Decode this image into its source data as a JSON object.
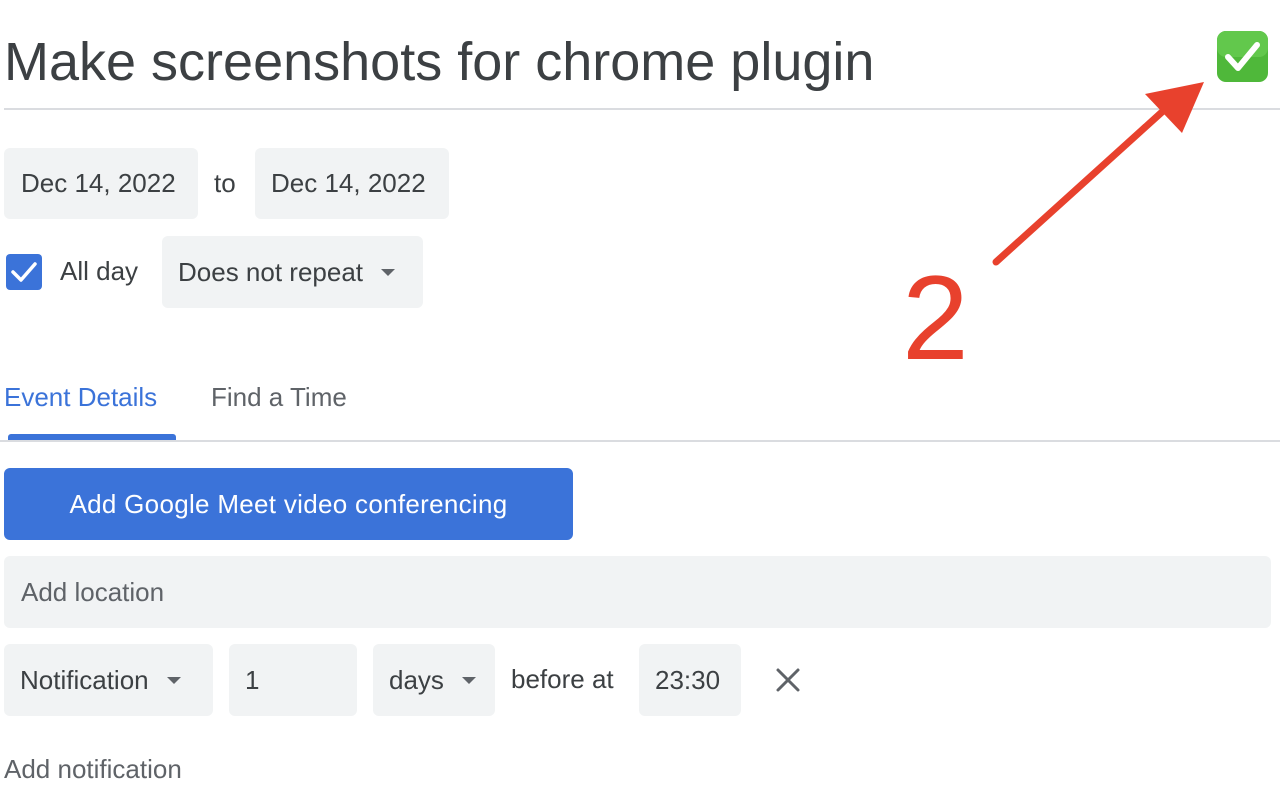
{
  "event": {
    "title": "Make screenshots for chrome plugin",
    "start_date": "Dec 14, 2022",
    "to_label": "to",
    "end_date": "Dec 14, 2022",
    "all_day_label": "All day",
    "all_day_checked": true,
    "repeat": "Does not repeat"
  },
  "tabs": [
    {
      "label": "Event Details",
      "active": true
    },
    {
      "label": "Find a Time",
      "active": false
    }
  ],
  "meet_button_label": "Add Google Meet video conferencing",
  "location_placeholder": "Add location",
  "notification": {
    "type": "Notification",
    "amount": "1",
    "unit": "days",
    "before_label": "before at",
    "time": "23:30"
  },
  "add_notification_label": "Add notification",
  "annotation": {
    "number": "2",
    "color": "#e8412d"
  },
  "icons": {
    "done": "check-mark-button-icon",
    "close": "close-icon",
    "checkbox": "checkbox-checked-icon"
  },
  "colors": {
    "accent": "#3b73d9",
    "chip_bg": "#f1f3f4",
    "done_green": "#4fb83a"
  }
}
